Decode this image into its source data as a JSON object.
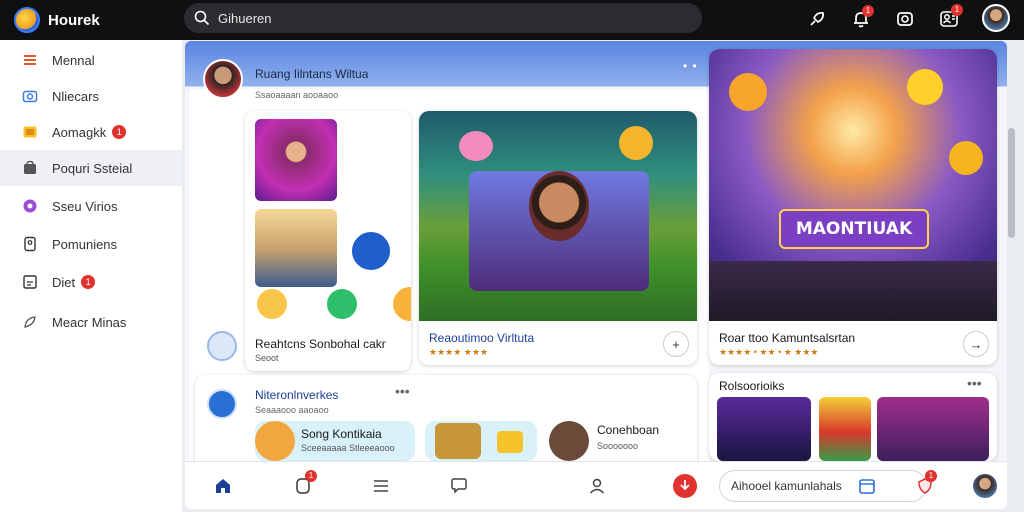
{
  "app": {
    "title": "Hourek"
  },
  "search": {
    "placeholder": "Gihueren"
  },
  "topbar": {
    "icons": [
      "rocket-icon",
      "bell-icon",
      "camera-icon",
      "people-icon"
    ],
    "bell_badge": "1",
    "people_badge": "1"
  },
  "sidebar": {
    "items": [
      {
        "label": "Mennal",
        "icon": "menu-icon"
      },
      {
        "label": "Nliecars",
        "icon": "camera-icon"
      },
      {
        "label": "Aomagkk",
        "icon": "folder-icon",
        "badge": "1"
      },
      {
        "label": "Poquri Ssteial",
        "icon": "bag-icon",
        "active": true
      },
      {
        "label": "Sseu Virios",
        "icon": "circle-icon"
      },
      {
        "label": "Pomuniens",
        "icon": "phone-icon"
      },
      {
        "label": "Diet",
        "icon": "book-icon",
        "badge": "1"
      },
      {
        "label": "Meacr Minas",
        "icon": "feather-icon"
      }
    ]
  },
  "header": {
    "title": "Ruang Iilntans Wiltua",
    "subtitle": "Ssaoaaaan aooaaoo",
    "dots": "• •"
  },
  "cards": {
    "collage": {
      "title": "Reahtcns Sonbohal cakr",
      "meta": "Seoot"
    },
    "featured": {
      "title": "Reaoutimoo Virltuta",
      "meta": "★★★★ ★★★"
    },
    "poster": {
      "title": "Roar ttoo Kamuntsalsrtan",
      "meta": "★★★★ • ★★ • ★ ★★★",
      "banner": "MAONTIUAK"
    },
    "list": {
      "title": "Niteronlnverkes",
      "sub": "Seaaaooo aaoaoo",
      "item1_title": "Song Kontikaia",
      "item1_sub": "Sceeaaaaa Stleeeaooo",
      "item3_title": "Conehboan",
      "item3_sub": "Sooooooo"
    },
    "recent": {
      "title": "Rolsoorioiks"
    }
  },
  "bottom": {
    "search_label": "Aihooel kamunlahals",
    "badge_notify": "1",
    "badge_profile": "1"
  },
  "colors": {
    "accent": "#5b84e0",
    "badge": "#e0332f",
    "topbar": "#0f1012"
  }
}
